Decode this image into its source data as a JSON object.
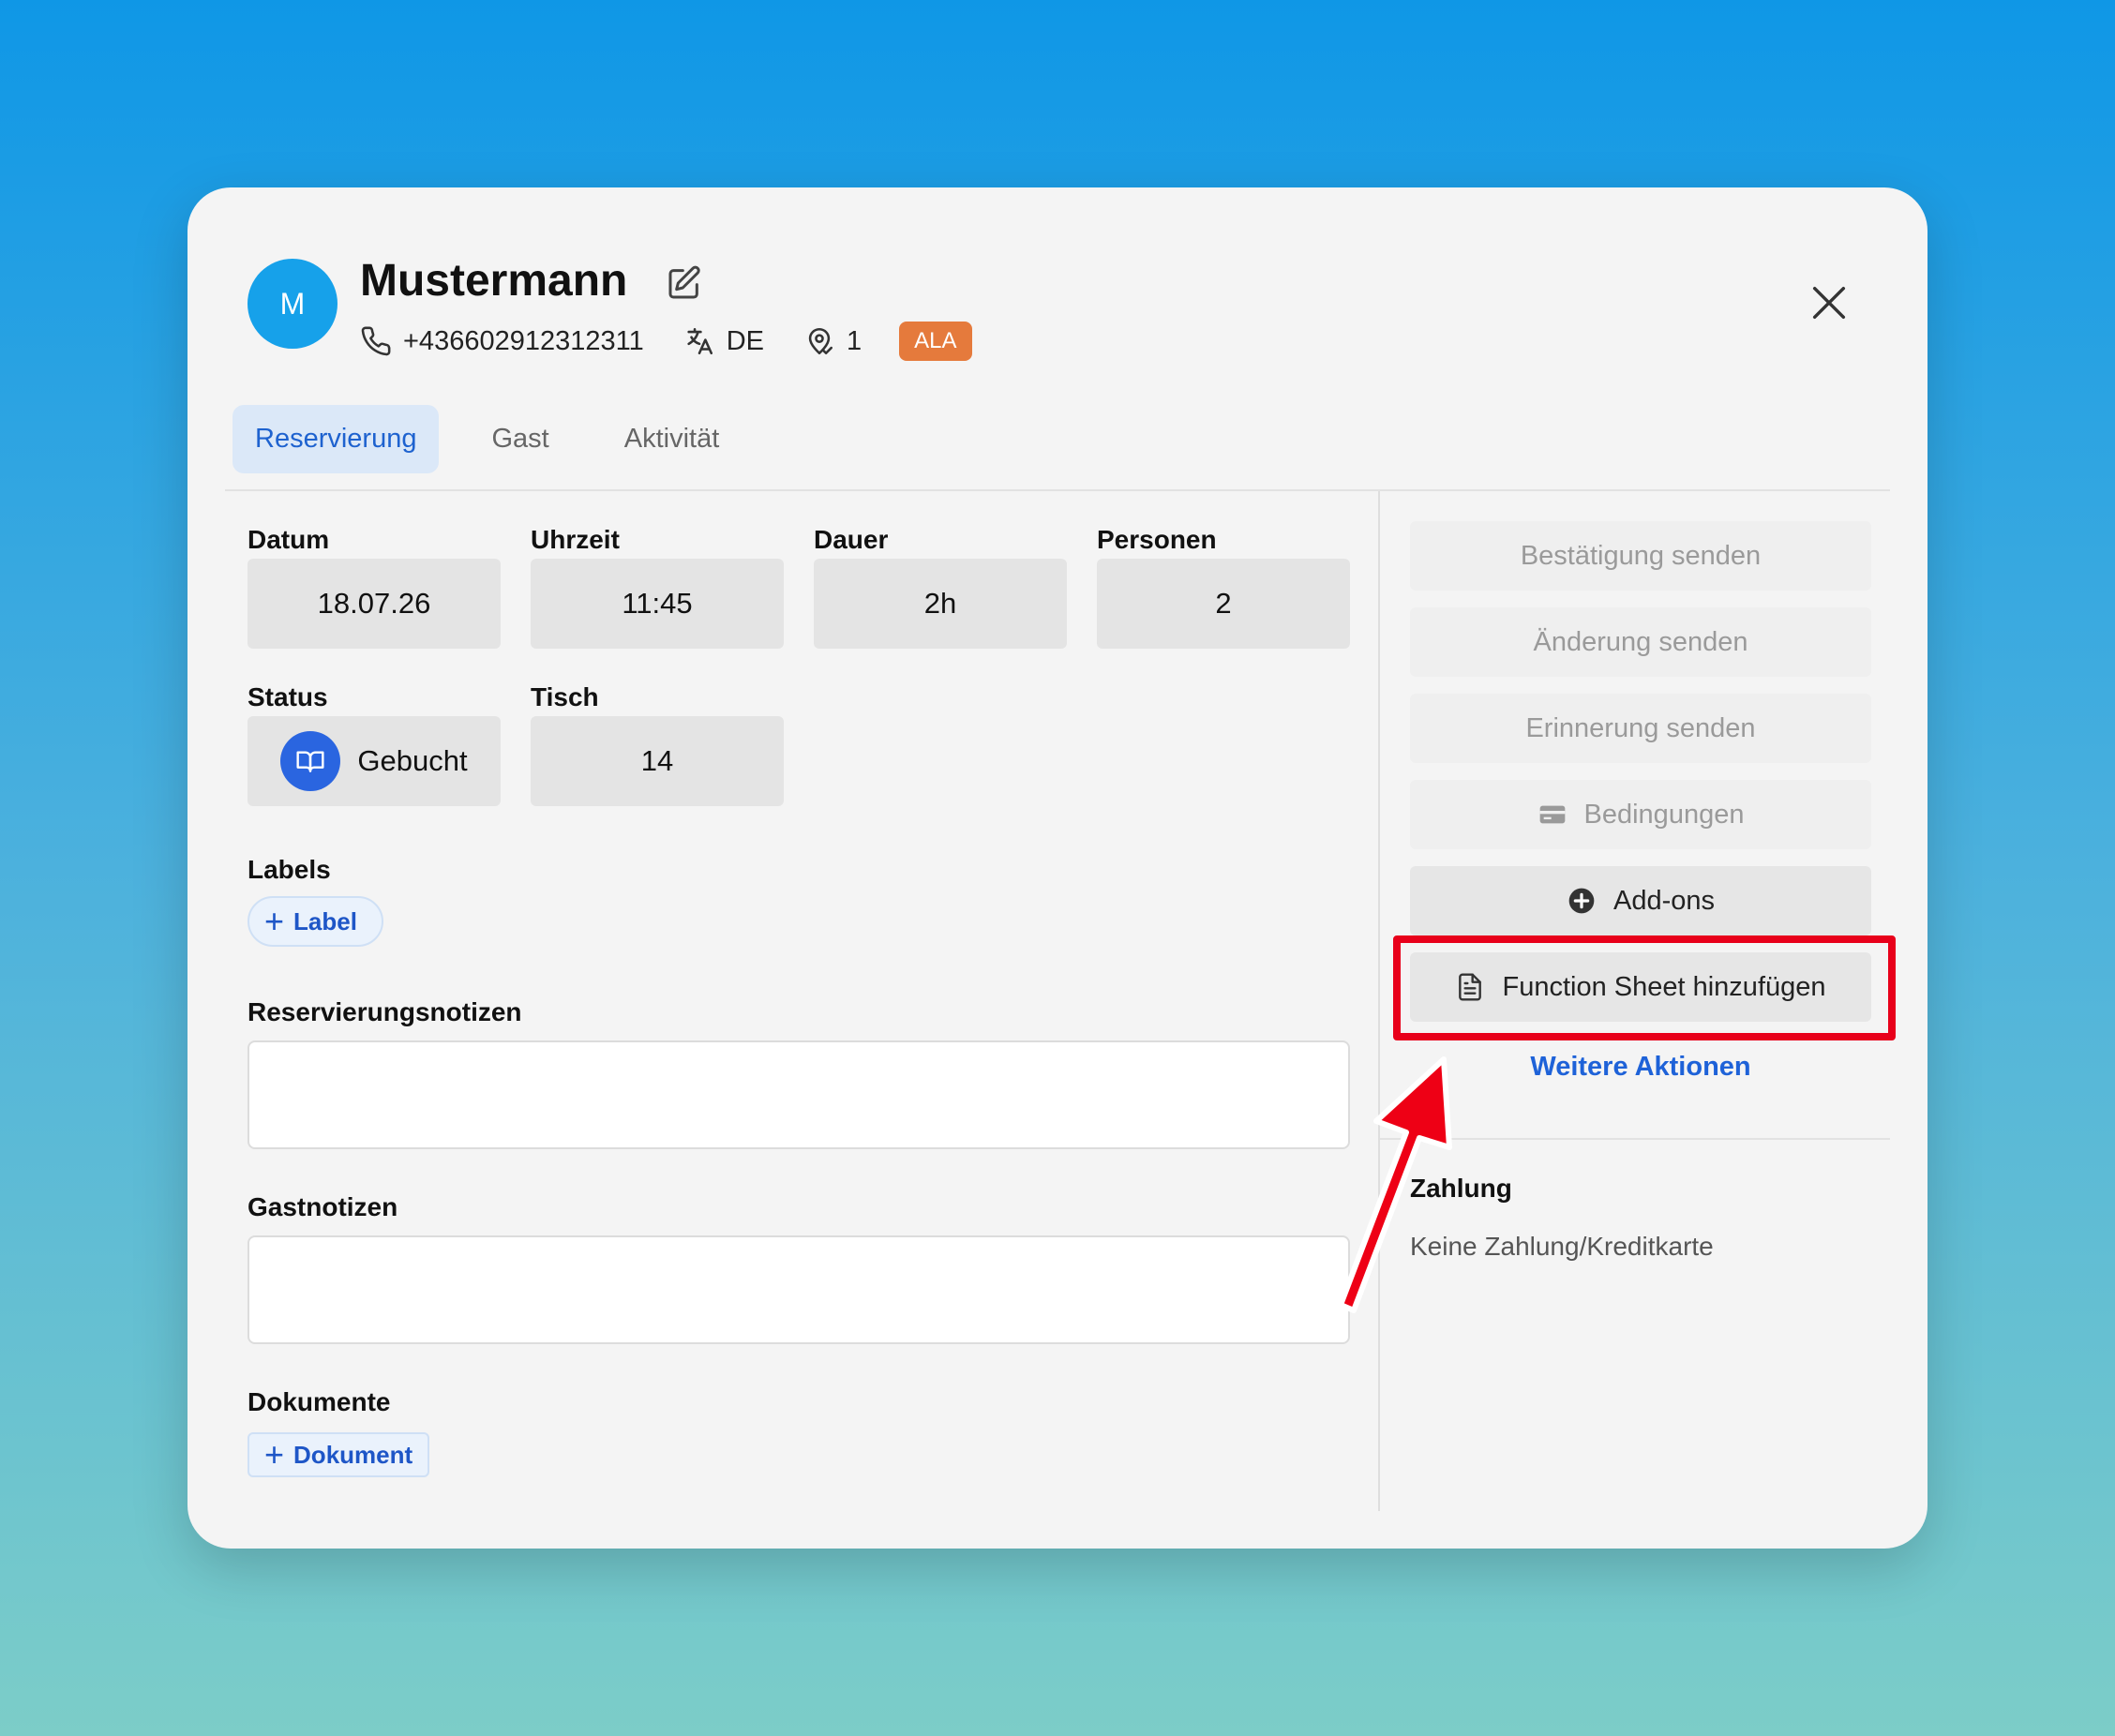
{
  "header": {
    "avatar_initial": "M",
    "guest_name": "Mustermann",
    "phone": "+436602912312311",
    "language": "DE",
    "location_count": "1",
    "badge": "ALA"
  },
  "tabs": [
    {
      "label": "Reservierung",
      "active": true
    },
    {
      "label": "Gast",
      "active": false
    },
    {
      "label": "Aktivität",
      "active": false
    }
  ],
  "reservation": {
    "date_label": "Datum",
    "date_value": "18.07.26",
    "time_label": "Uhrzeit",
    "time_value": "11:45",
    "duration_label": "Dauer",
    "duration_value": "2h",
    "persons_label": "Personen",
    "persons_value": "2",
    "status_label": "Status",
    "status_value": "Gebucht",
    "table_label": "Tisch",
    "table_value": "14",
    "labels_label": "Labels",
    "add_label": "Label",
    "reservation_notes_label": "Reservierungsnotizen",
    "guest_notes_label": "Gastnotizen",
    "documents_label": "Dokumente",
    "add_document": "Dokument"
  },
  "actions": {
    "send_confirmation": "Bestätigung senden",
    "send_change": "Änderung senden",
    "send_reminder": "Erinnerung senden",
    "conditions": "Bedingungen",
    "addons": "Add-ons",
    "add_function_sheet": "Function Sheet hinzufügen",
    "more_actions": "Weitere Aktionen"
  },
  "payment": {
    "title": "Zahlung",
    "text": "Keine Zahlung/Kreditkarte"
  },
  "colors": {
    "accent": "#1e62cf",
    "avatar": "#16a1ea",
    "badge": "#e57a3c",
    "highlight": "#e8001a",
    "status": "#2a65e0"
  }
}
